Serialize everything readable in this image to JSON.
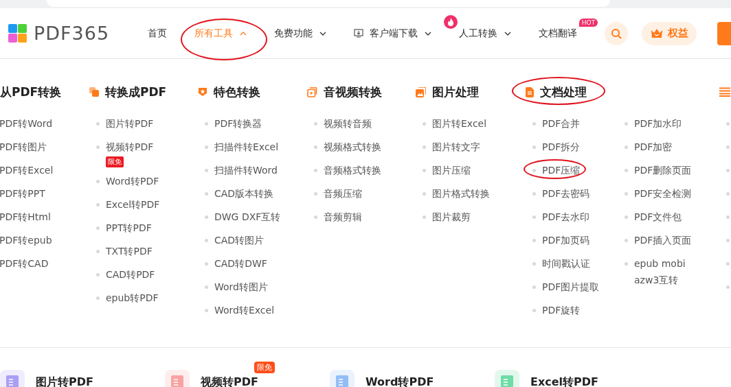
{
  "header": {
    "logo": "PDF365",
    "nav": [
      {
        "label": "首页",
        "kind": "plain",
        "selected": false
      },
      {
        "label": "所有工具",
        "kind": "dropdown",
        "selected": true
      },
      {
        "label": "免费功能",
        "kind": "dropdown",
        "selected": false
      },
      {
        "label": "客户端下载",
        "kind": "download",
        "selected": false
      },
      {
        "label": "人工转换",
        "kind": "hot-fire",
        "selected": false
      },
      {
        "label": "文档翻译",
        "kind": "hot-text",
        "badge": "HOT",
        "selected": false
      }
    ],
    "benefits_button": "权益"
  },
  "categories": [
    {
      "title": "从PDF转换",
      "kind": "none",
      "columns": [
        [
          {
            "label": "PDF转Word"
          },
          {
            "label": "PDF转图片"
          },
          {
            "label": "PDF转Excel"
          },
          {
            "label": "PDF转PPT"
          },
          {
            "label": "PDF转Html"
          },
          {
            "label": "PDF转epub"
          },
          {
            "label": "PDF转CAD"
          }
        ]
      ]
    },
    {
      "title": "转换成PDF",
      "kind": "to-pdf",
      "columns": [
        [
          {
            "label": "图片转PDF"
          },
          {
            "label": "视频转PDF",
            "badge": "限免"
          },
          {
            "label": "Word转PDF"
          },
          {
            "label": "Excel转PDF"
          },
          {
            "label": "PPT转PDF"
          },
          {
            "label": "TXT转PDF"
          },
          {
            "label": "CAD转PDF"
          },
          {
            "label": "epub转PDF"
          }
        ]
      ]
    },
    {
      "title": "特色转换",
      "kind": "star",
      "columns": [
        [
          {
            "label": "PDF转换器"
          },
          {
            "label": "扫描件转Excel"
          },
          {
            "label": "扫描件转Word"
          },
          {
            "label": "CAD版本转换"
          },
          {
            "label": "DWG DXF互转"
          },
          {
            "label": "CAD转图片"
          },
          {
            "label": "CAD转DWF"
          },
          {
            "label": "Word转图片"
          },
          {
            "label": "Word转Excel"
          }
        ]
      ]
    },
    {
      "title": "音视频转换",
      "kind": "video",
      "columns": [
        [
          {
            "label": "视频转音频"
          },
          {
            "label": "视频格式转换"
          },
          {
            "label": "音频格式转换"
          },
          {
            "label": "音频压缩"
          },
          {
            "label": "音频剪辑"
          }
        ]
      ]
    },
    {
      "title": "图片处理",
      "kind": "image",
      "columns": [
        [
          {
            "label": "图片转Excel"
          },
          {
            "label": "图片转文字"
          },
          {
            "label": "图片压缩"
          },
          {
            "label": "图片格式转换"
          },
          {
            "label": "图片裁剪"
          }
        ]
      ]
    },
    {
      "title": "文档处理",
      "kind": "document",
      "columns": [
        [
          {
            "label": "PDF合并"
          },
          {
            "label": "PDF拆分"
          },
          {
            "label": "PDF压缩"
          },
          {
            "label": "PDF去密码"
          },
          {
            "label": "PDF去水印"
          },
          {
            "label": "PDF加页码"
          },
          {
            "label": "时间戳认证"
          },
          {
            "label": "PDF图片提取"
          },
          {
            "label": "PDF旋转"
          }
        ],
        [
          {
            "label": "PDF加水印"
          },
          {
            "label": "PDF加密"
          },
          {
            "label": "PDF删除页面"
          },
          {
            "label": "PDF安全检测"
          },
          {
            "label": "PDF文件包"
          },
          {
            "label": "PDF插入页面"
          },
          {
            "label": "epub mobi azw3互转"
          }
        ]
      ]
    }
  ],
  "featured": [
    {
      "title": "图片转PDF",
      "color": "#a99ff7"
    },
    {
      "title": "视频转PDF",
      "badge": "限免",
      "color": "#f8a3a3"
    },
    {
      "title": "Word转PDF",
      "color": "#93bdf7"
    },
    {
      "title": "Excel转PDF",
      "color": "#6fdca6"
    }
  ]
}
